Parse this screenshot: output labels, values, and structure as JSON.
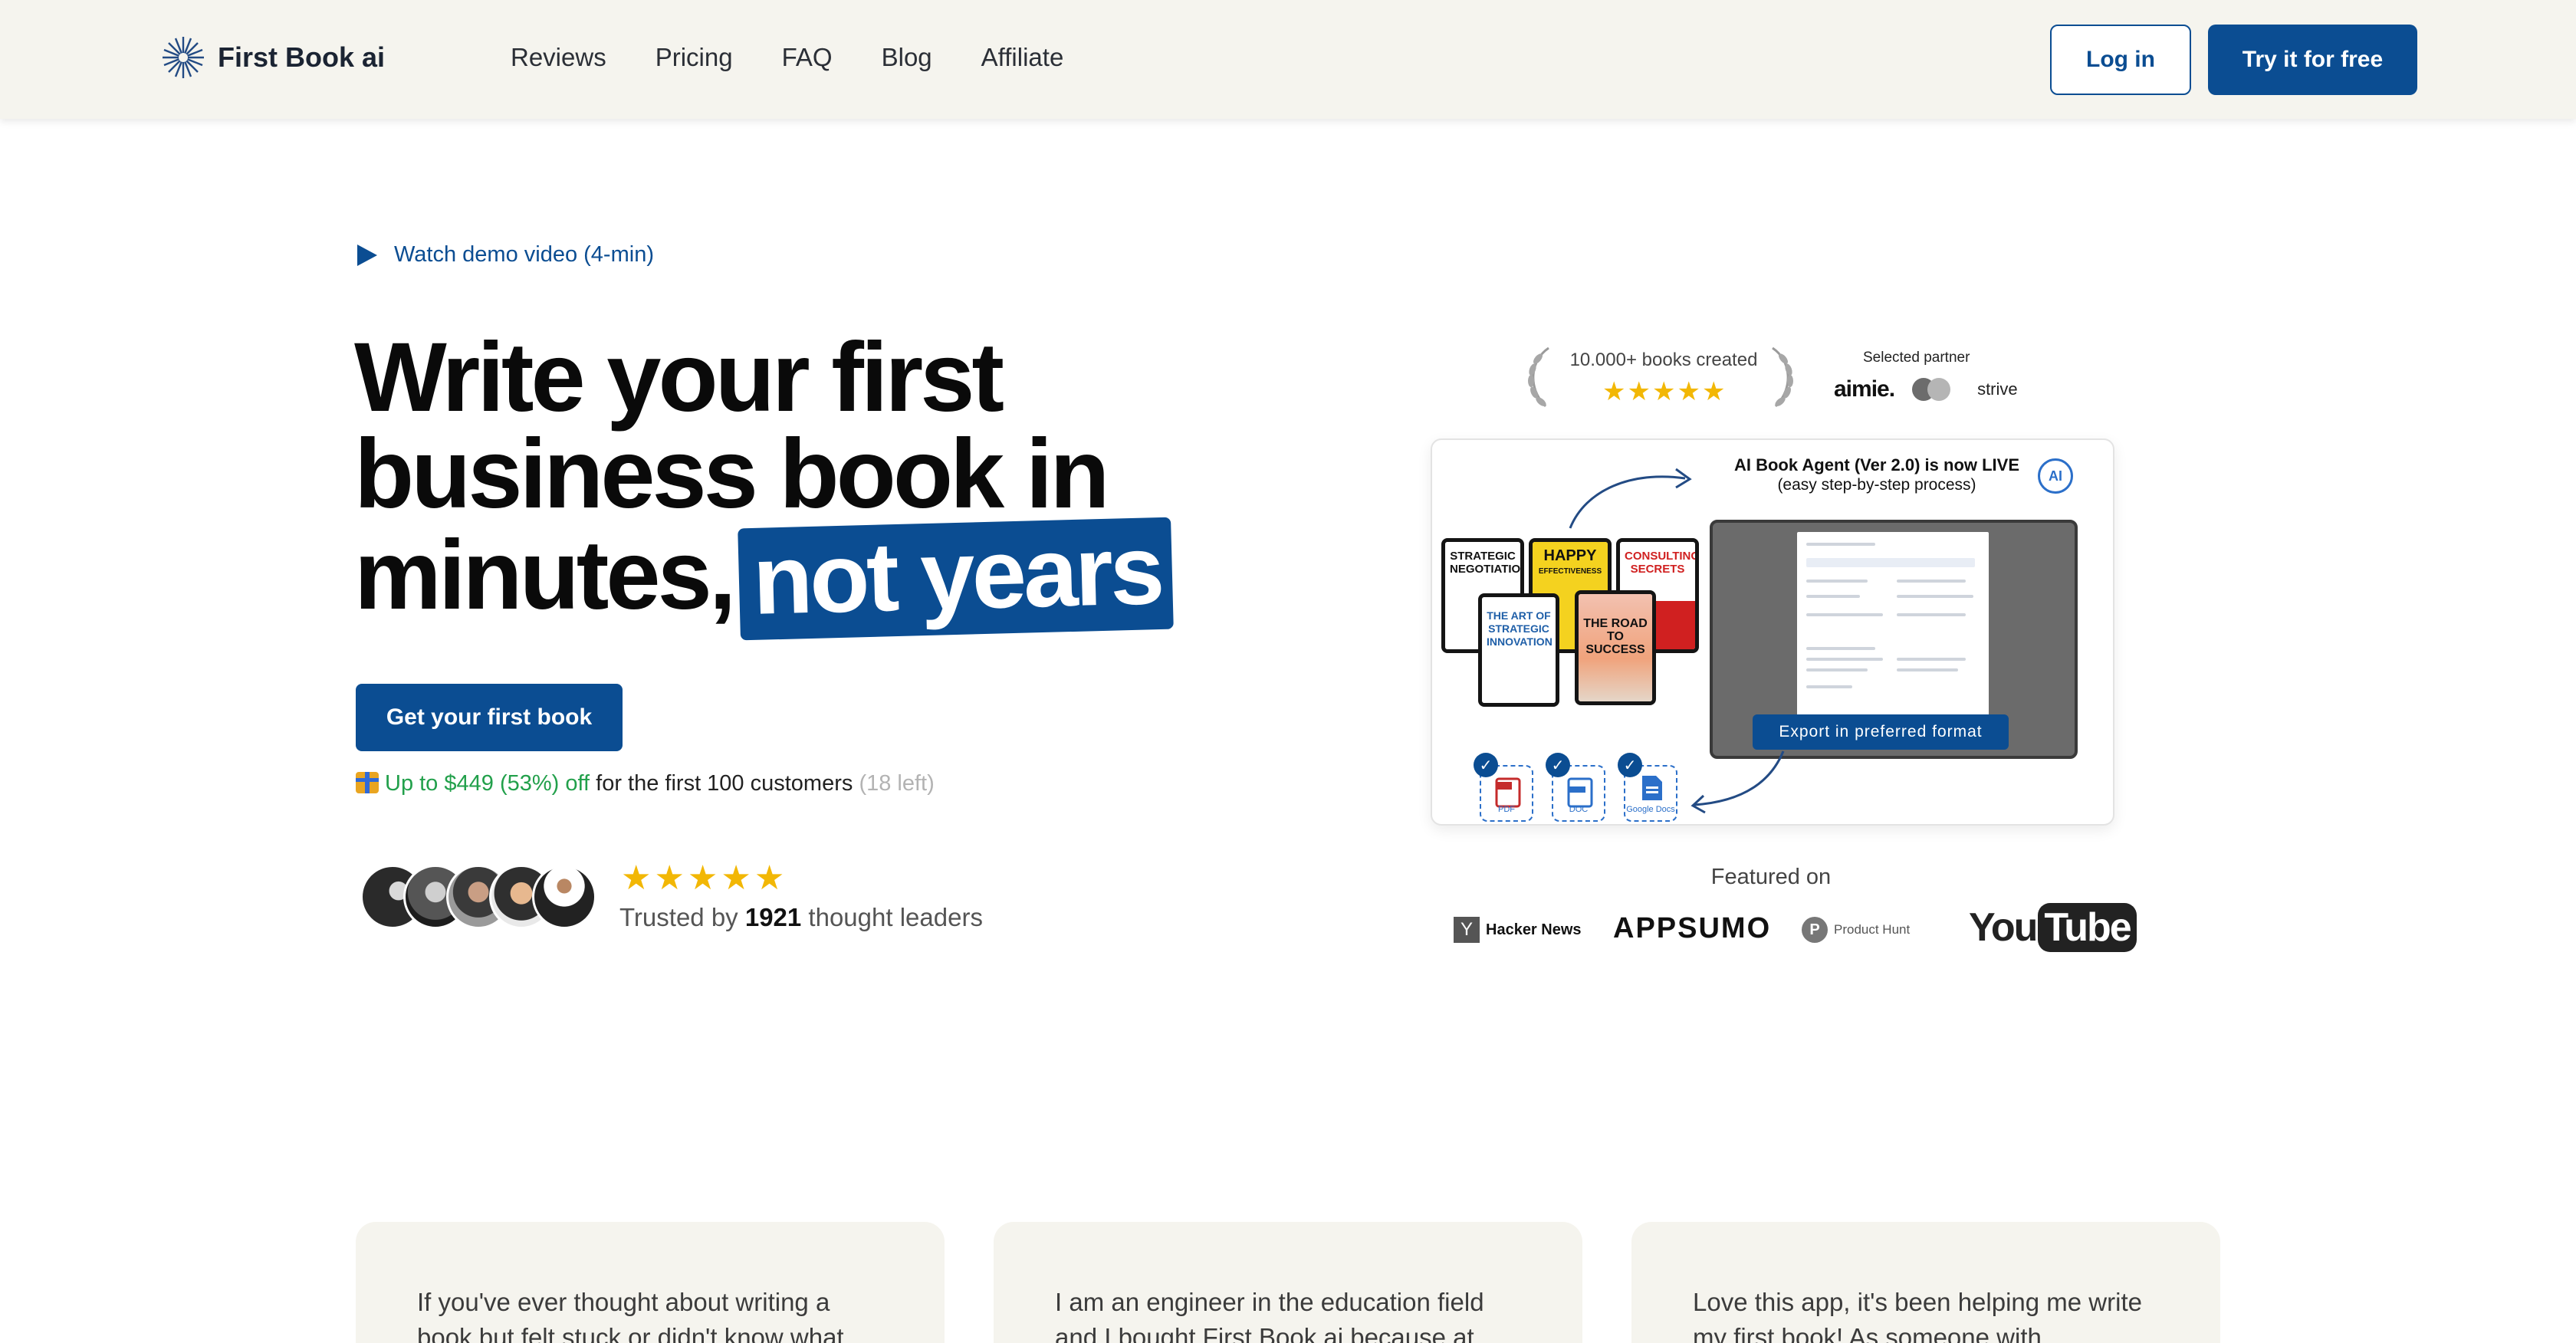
{
  "brand": {
    "name": "First Book ai"
  },
  "nav": [
    "Reviews",
    "Pricing",
    "FAQ",
    "Blog",
    "Affiliate"
  ],
  "header": {
    "login": "Log in",
    "try": "Try it for free"
  },
  "hero": {
    "demo": "Watch demo video (4-min)",
    "headline": [
      "Write your first",
      "business book in",
      "minutes,"
    ],
    "highlight": "not years",
    "cta": "Get your first book",
    "offer": {
      "discount": "Up to $449 (53%) off",
      "rest": " for the first 100 customers ",
      "left": "(18 left)"
    },
    "trusted": {
      "pre": "Trusted by ",
      "count": "1921",
      "post": " thought leaders"
    },
    "rating_stars": 5
  },
  "badges": {
    "books_created": "10.000+ books created",
    "partner_label": "Selected partner",
    "partners": [
      "aimie.",
      "strive"
    ]
  },
  "demo_card": {
    "title": "AI Book Agent (Ver 2.0) is now LIVE",
    "subtitle": "(easy step-by-step process)",
    "ai_badge": "AI",
    "books": [
      {
        "title": "STRATEGIC NEGOTIATION"
      },
      {
        "title": "HAPPY",
        "subtitle": "EFFECTIVENESS"
      },
      {
        "title": "CONSULTING SECRETS"
      },
      {
        "title": "THE ART OF STRATEGIC INNOVATION"
      },
      {
        "title": "THE ROAD TO SUCCESS"
      }
    ],
    "export": "Export in preferred format",
    "formats": [
      "PDF",
      "DOC",
      "Google Docs"
    ]
  },
  "featured": {
    "label": "Featured on",
    "hn": "Hacker News",
    "hn_mark": "Y",
    "appsumo": "APPSUMO",
    "ph": "Product Hunt",
    "ph_mark": "P",
    "yt_you": "You",
    "yt_tube": "Tube"
  },
  "testimonials": [
    "If you've ever thought about writing a book but felt stuck or didn't know what",
    "I am an engineer in the education field and I bought First Book ai because at",
    "Love this app, it's been helping me write my first book! As someone with"
  ],
  "colors": {
    "primary": "#0b4d92",
    "header_bg": "#f5f4ee",
    "green": "#22a04b",
    "star": "#f2b705"
  }
}
